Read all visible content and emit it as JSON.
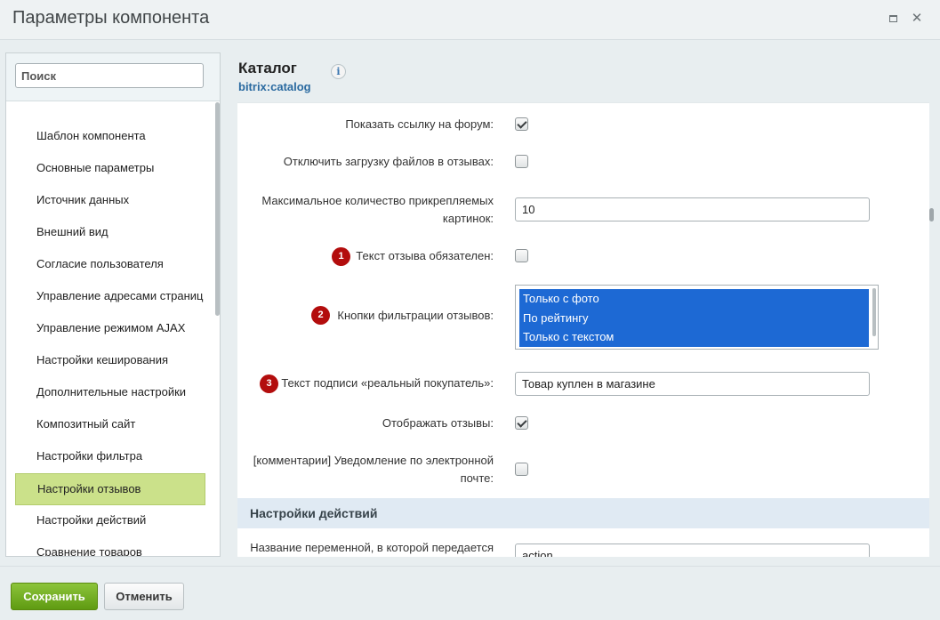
{
  "window": {
    "title": "Параметры компонента",
    "maximize_icon": "maximize-icon",
    "close_icon": "close-icon",
    "close_glyph": "✕"
  },
  "sidebar": {
    "search_placeholder": "Поиск",
    "items": [
      {
        "label": "Шаблон компонента",
        "active": false
      },
      {
        "label": "Основные параметры",
        "active": false
      },
      {
        "label": "Источник данных",
        "active": false
      },
      {
        "label": "Внешний вид",
        "active": false
      },
      {
        "label": "Согласие пользователя",
        "active": false
      },
      {
        "label": "Управление адресами страниц",
        "active": false
      },
      {
        "label": "Управление режимом AJAX",
        "active": false
      },
      {
        "label": "Настройки кеширования",
        "active": false
      },
      {
        "label": "Дополнительные настройки",
        "active": false
      },
      {
        "label": "Композитный сайт",
        "active": false
      },
      {
        "label": "Настройки фильтра",
        "active": false
      },
      {
        "label": "Настройки отзывов",
        "active": true
      },
      {
        "label": "Настройки действий",
        "active": false
      },
      {
        "label": "Сравнение товаров",
        "active": false
      }
    ]
  },
  "component": {
    "title": "Каталог",
    "code": "bitrix:catalog",
    "info_icon": "info-icon",
    "info_glyph": "i"
  },
  "form": {
    "show_forum_link": {
      "label": "Показать ссылку на форум:",
      "checked": true
    },
    "disable_file_upload": {
      "label": "Отключить загрузку файлов в отзывах:",
      "checked": false
    },
    "max_images": {
      "label_line1": "Максимальное количество прикрепляемых",
      "label_line2": "картинок:",
      "value": "10"
    },
    "review_text_required": {
      "badge": "1",
      "label": "Текст отзыва обязателен:",
      "checked": false
    },
    "filter_buttons": {
      "badge": "2",
      "label": "Кнопки фильтрации отзывов:",
      "options": [
        "Только с фото",
        "По рейтингу",
        "Только с текстом"
      ]
    },
    "real_buyer_caption": {
      "badge": "3",
      "label": "Текст подписи «реальный покупатель»:",
      "value": "Товар куплен в магазине"
    },
    "show_reviews": {
      "label": "Отображать отзывы:",
      "checked": true
    },
    "email_notify": {
      "label_line1": "[комментарии] Уведомление по электронной",
      "label_line2": "почте:",
      "checked": false
    },
    "actions_section": {
      "title": "Настройки действий"
    },
    "action_variable": {
      "label": "Название переменной, в которой передается",
      "value": "action"
    }
  },
  "footer": {
    "save_label": "Сохранить",
    "cancel_label": "Отменить"
  },
  "colors": {
    "active_item": "#cbe18a",
    "badge": "#b30d0d",
    "selected_option": "#1d69d4",
    "save_button": "#6fa91f",
    "section_header": "#e0eaf3",
    "component_code": "#2a6aa0"
  }
}
